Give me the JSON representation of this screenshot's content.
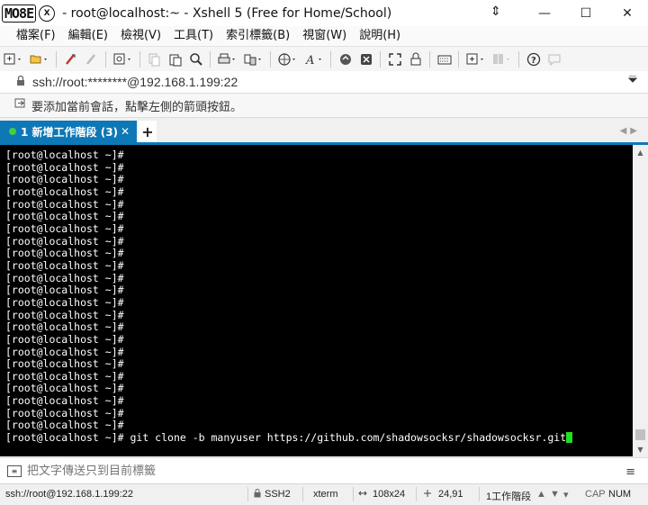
{
  "app": {
    "logo_text": "MO8E",
    "logo_mark": "X",
    "title": "- root@localhost:~ - Xshell 5 (Free for Home/School)"
  },
  "window_controls": {
    "minimize": "—",
    "maximize": "☐",
    "close": "✕",
    "move": "⇕"
  },
  "menu": {
    "items": [
      "檔案(F)",
      "編輯(E)",
      "檢視(V)",
      "工具(T)",
      "索引標籤(B)",
      "視窗(W)",
      "說明(H)"
    ]
  },
  "address": {
    "value": "ssh://root:********@192.168.1.199:22"
  },
  "info": {
    "text": "要添加當前會話，點擊左側的箭頭按鈕。"
  },
  "tabs": [
    {
      "label": "1 新增工作階段 (3)",
      "active": true,
      "status_color": "#3fd23f"
    }
  ],
  "tab_add_label": "+",
  "terminal": {
    "prompt": "[root@localhost ~]#",
    "empty_prompt_count": 23,
    "last_command": " git clone -b manyuser https://github.com/shadowsocksr/shadowsocksr.git",
    "cursor_color": "#22e022"
  },
  "compose": {
    "placeholder": "把文字傳送只到目前標籤",
    "menu_icon": "≡"
  },
  "status": {
    "connection": "ssh://root@192.168.1.199:22",
    "protocol": "SSH2",
    "terminal_type": "xterm",
    "size": "108x24",
    "cursor_pos": "24,91",
    "sessions": "1工作階段",
    "caps": "CAP",
    "num": "NUM"
  },
  "colors": {
    "accent": "#0e78b7",
    "terminal_bg": "#000000",
    "terminal_fg": "#ffffff"
  }
}
